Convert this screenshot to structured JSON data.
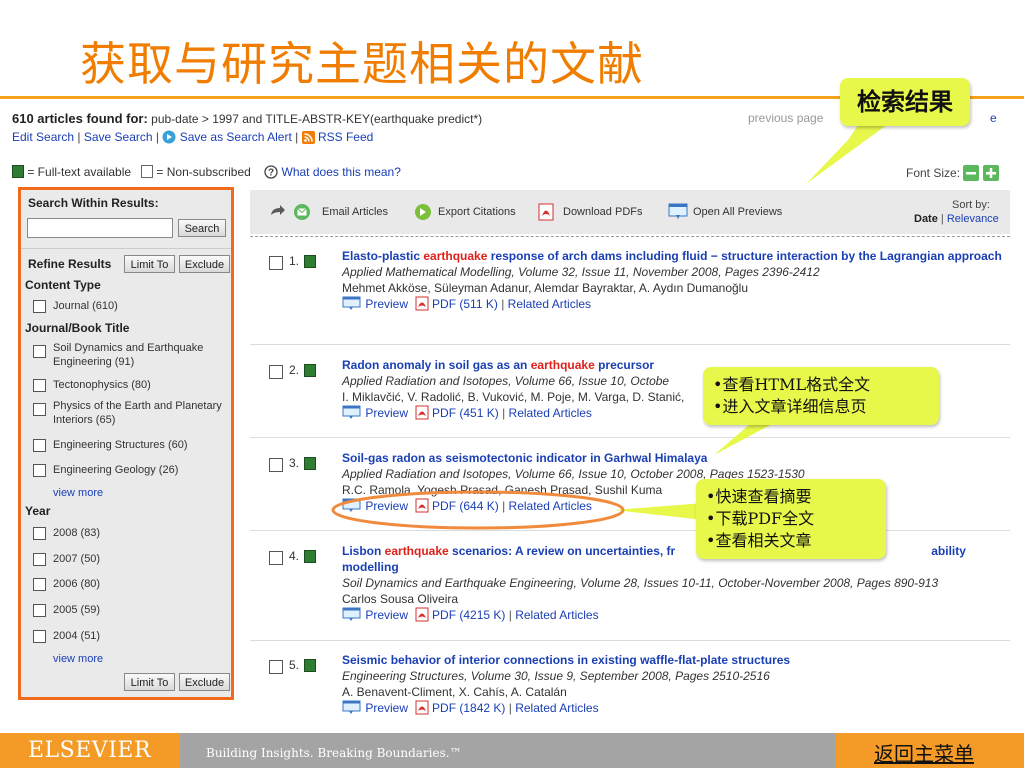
{
  "slide": {
    "title": "获取与研究主题相关的文献"
  },
  "search_header": {
    "count_label": "610 articles found for:",
    "query": "pub-date > 1997 and TITLE-ABSTR-KEY(earthquake predict*)",
    "edit_search": "Edit Search",
    "save_search": "Save Search",
    "save_alert": "Save as Search Alert",
    "rss": "RSS Feed",
    "sep": "|",
    "previous_page": "previous page",
    "next_page": "e"
  },
  "legend": {
    "fulltext": "= Full-text available",
    "nonsub": "= Non-subscribed",
    "what": "What does this mean?",
    "font_size": "Font Size:"
  },
  "left_panel": {
    "search_within": "Search Within Results:",
    "search_button": "Search",
    "refine": "Refine Results",
    "limit_to": "Limit To",
    "exclude": "Exclude",
    "content_type": "Content Type",
    "journal": "Journal (610)",
    "journal_book_title": "Journal/Book Title",
    "titles": [
      {
        "line1": "Soil Dynamics and Earthquake",
        "line2": "Engineering (91)"
      },
      {
        "line1": "Tectonophysics (80)",
        "line2": ""
      },
      {
        "line1": "Physics of the Earth and Planetary",
        "line2": "Interiors (65)"
      },
      {
        "line1": "Engineering Structures (60)",
        "line2": ""
      },
      {
        "line1": "Engineering Geology (26)",
        "line2": ""
      }
    ],
    "view_more": "view more",
    "year": "Year",
    "years": [
      "2008 (83)",
      "2007 (50)",
      "2006 (80)",
      "2005 (59)",
      "2004 (51)"
    ]
  },
  "toolbar": {
    "email": "Email Articles",
    "export": "Export Citations",
    "download": "Download PDFs",
    "previews": "Open All Previews",
    "sort_by": "Sort by:",
    "date": "Date",
    "sep": "|",
    "relevance": "Relevance"
  },
  "results": [
    {
      "num": "1.",
      "title_pre": "Elasto-plastic ",
      "title_hl": "earthquake",
      "title_post": " response of arch dams including fluid − structure interaction by the Lagrangian approach",
      "source": "Applied Mathematical Modelling, Volume 32, Issue 11, November 2008, Pages 2396-2412",
      "authors": "Mehmet Akköse, Süleyman Adanur, Alemdar Bayraktar, A. Aydın Dumanoğlu",
      "preview": "Preview",
      "pdf": "PDF (511 K)",
      "related": "Related Articles"
    },
    {
      "num": "2.",
      "title_pre": "Radon anomaly in soil gas as an ",
      "title_hl": "earthquake",
      "title_post": " precursor",
      "source": "Applied Radiation and Isotopes, Volume 66, Issue 10, Octobe",
      "authors": "I. Miklavčić, V. Radolić, B. Vuković, M. Poje, M. Varga, D. Stanić,",
      "preview": "Preview",
      "pdf": "PDF (451 K)",
      "related": "Related Articles"
    },
    {
      "num": "3.",
      "title_pre": "Soil-gas radon as seismotectonic indicator in Garhwal Himalaya",
      "title_hl": "",
      "title_post": "",
      "source": "Applied Radiation and Isotopes, Volume 66, Issue 10, October 2008, Pages 1523-1530",
      "authors": "R.C. Ramola, Yogesh Prasad, Ganesh Prasad, Sushil Kuma",
      "preview": "Preview",
      "pdf": "PDF (644 K)",
      "related": "Related Articles"
    },
    {
      "num": "4.",
      "title_pre": "Lisbon ",
      "title_hl": "earthquake",
      "title_post": " scenarios: A review on uncertainties, fr",
      "title_tail": "ability modelling",
      "source": "Soil Dynamics and Earthquake Engineering, Volume 28, Issues 10-11, October-November 2008, Pages 890-913",
      "authors": "Carlos Sousa Oliveira",
      "preview": "Preview",
      "pdf": "PDF (4215 K)",
      "related": "Related Articles"
    },
    {
      "num": "5.",
      "title_pre": "Seismic behavior of interior connections in existing waffle-flat-plate structures",
      "title_hl": "",
      "title_post": "",
      "source": "Engineering Structures, Volume 30, Issue 9, September 2008, Pages 2510-2516",
      "authors": "A. Benavent-Climent, X. Cahís, A. Catalán",
      "preview": "Preview",
      "pdf": "PDF (1842 K)",
      "related": "Related Articles"
    }
  ],
  "callouts": {
    "results": "检索结果",
    "html_1": "•查看HTML格式全文",
    "html_2": "•进入文章详细信息页",
    "preview_1": "•快速查看摘要",
    "preview_2": "•下载PDF全文",
    "preview_3": "•查看相关文章"
  },
  "footer": {
    "brand": "ELSEVIER",
    "tagline": "Building Insights. Breaking Boundaries.™",
    "back": "返回主菜单"
  },
  "colors": {
    "title_orange": "#f07d00",
    "panel_border": "#f26a1b",
    "link_blue": "#1a3fb5",
    "highlight_red": "#e0201a",
    "callout_yellow": "#e8f84a",
    "footer_orange": "#f49a26",
    "footer_gray": "#a4a4a4"
  }
}
